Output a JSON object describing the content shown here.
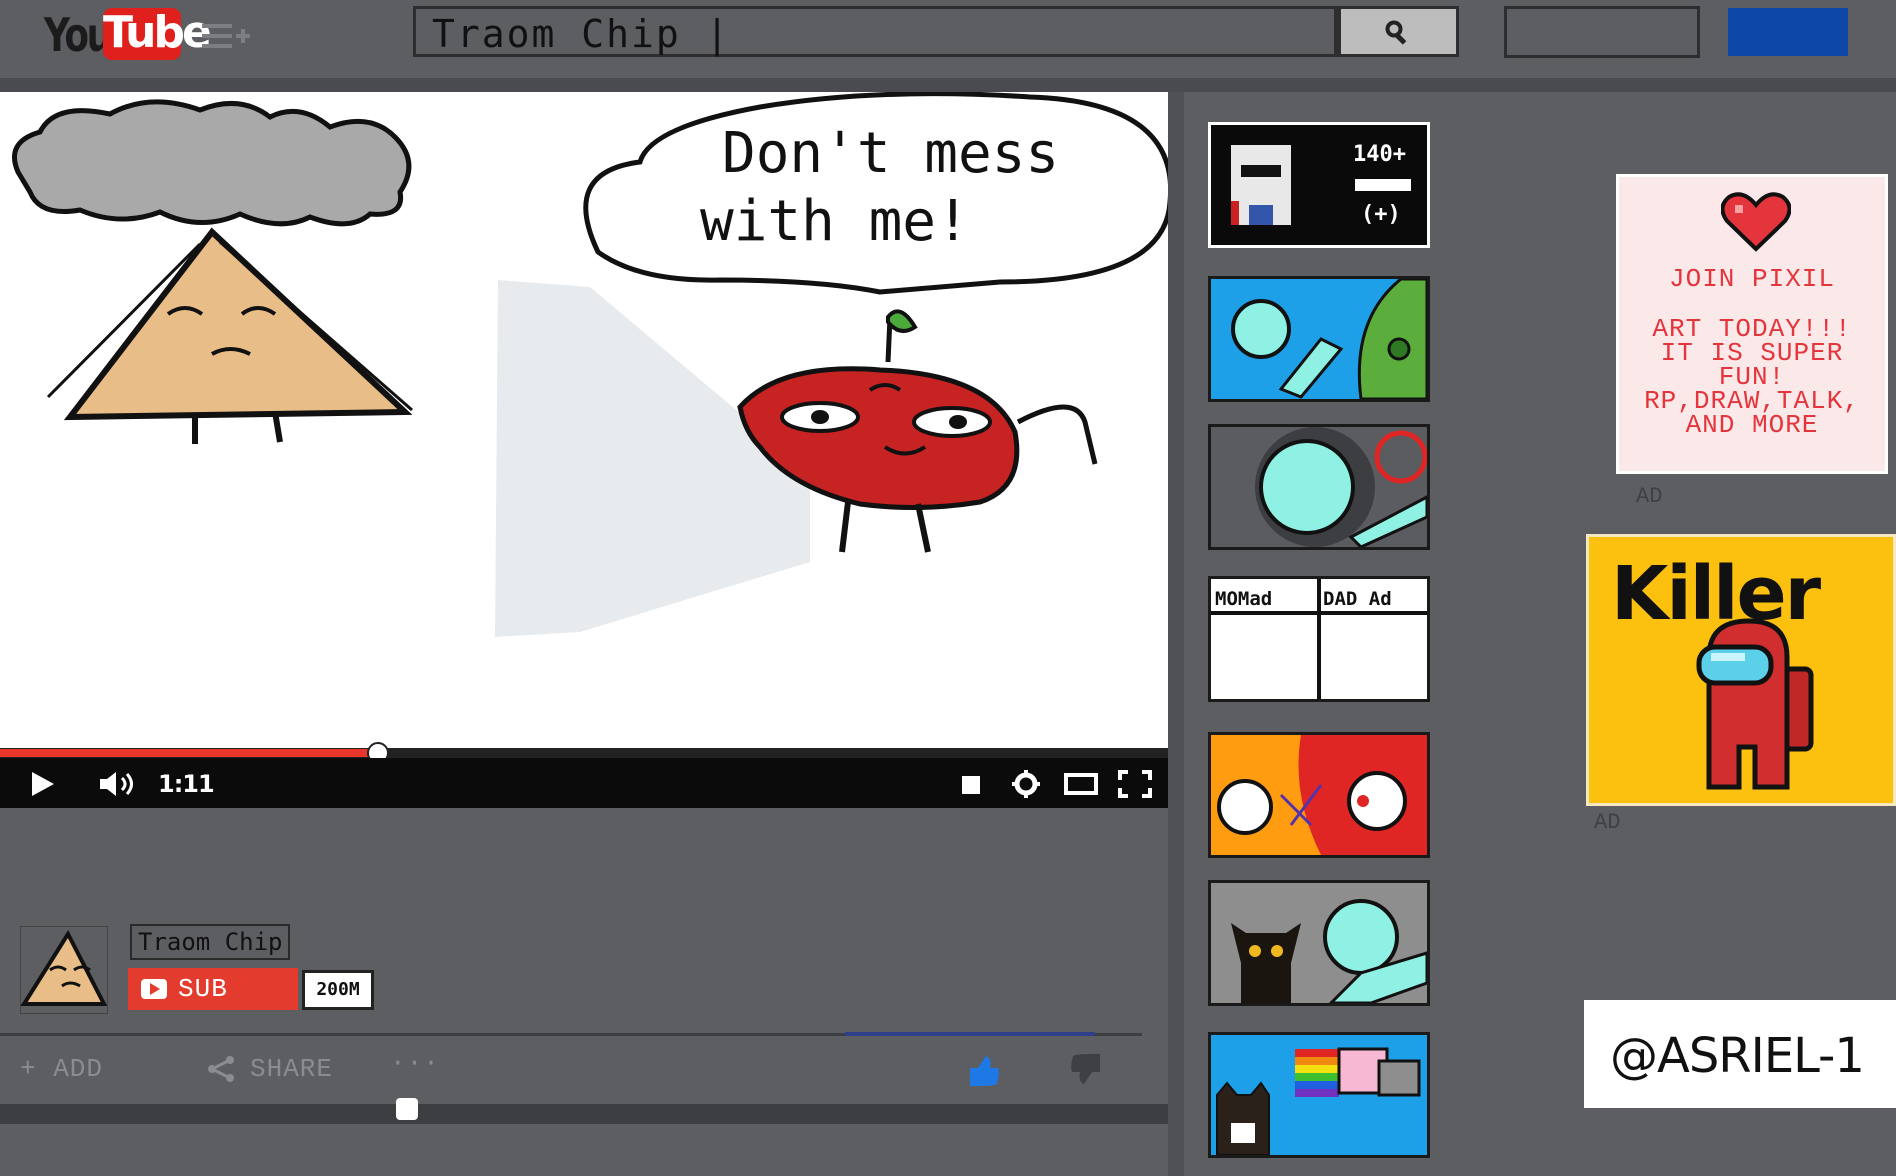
{
  "header": {
    "logo_you": "You",
    "logo_tube": "Tube",
    "search_value": "Traom Chip |"
  },
  "artwork": {
    "speech_line1": "Don't mess",
    "speech_line2": "with me!"
  },
  "player": {
    "time": "1:11",
    "progress": 0.32
  },
  "channel": {
    "name": "Traom Chip",
    "subscribe_label": "SUB",
    "subscriber_count": "200M"
  },
  "actions": {
    "add_label": "+ ADD",
    "share_label": "SHARE",
    "more_label": "···"
  },
  "sidebar": {
    "thumb1_line1": "140+",
    "thumb1_line2": "(+)",
    "thumb4_left": "MOMad",
    "thumb4_right": "DAD  Ad"
  },
  "ads": {
    "pixil_line1": "JOIN PIXIL",
    "pixil_line2": "ART TODAY!!!",
    "pixil_line3": "IT IS SUPER",
    "pixil_line4": "FUN!",
    "pixil_line5": "RP,DRAW,TALK,",
    "pixil_line6": "AND MORE",
    "ad_label_1": "AD",
    "killer_text": "Killer",
    "ad_label_2": "AD"
  },
  "credit": "@ASRIEL-1",
  "colors": {
    "page_bg": "#5c5e62",
    "youtube_red": "#e0201d",
    "progress_red": "#e8362c",
    "upload_blue": "#0d48a8",
    "ad_yellow": "#fcc00f",
    "ad_pink": "#fbe9ea"
  }
}
